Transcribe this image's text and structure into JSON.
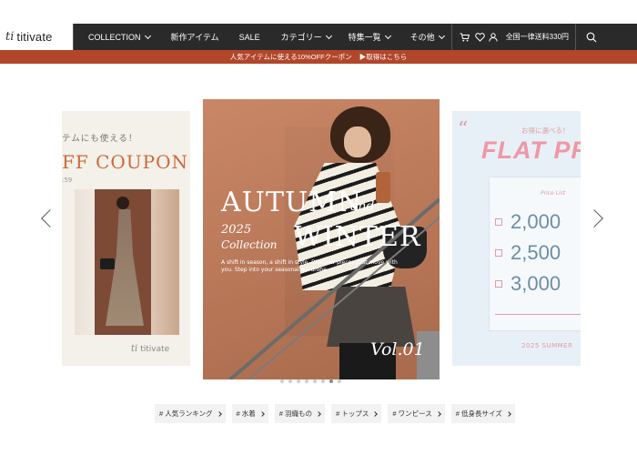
{
  "header": {
    "logo_mark": "ti",
    "logo_text": "titivate",
    "nav": [
      {
        "label": "COLLECTION",
        "dropdown": true
      },
      {
        "label": "新作アイテム",
        "dropdown": false
      },
      {
        "label": "SALE",
        "dropdown": false
      },
      {
        "label": "カテゴリー",
        "dropdown": true
      },
      {
        "label": "特集一覧",
        "dropdown": true
      },
      {
        "label": "その他",
        "dropdown": true
      }
    ],
    "shipping": "全国一律送料330円",
    "icons": [
      "cart-icon",
      "heart-icon",
      "user-icon",
      "search-icon"
    ]
  },
  "coupon_bar": {
    "text": "人気アイテムに使える10%OFFクーポン",
    "link": "▶取得はこちら",
    "color": "#b2462a"
  },
  "carousel": {
    "left_slide": {
      "headline_small": "テムにも使える！",
      "headline": "FF COUPON",
      "subtext": ":59",
      "brand": "titivate"
    },
    "main_slide": {
      "title_1": "AUTUMN",
      "title_and": "and",
      "year": "2025",
      "collection": "Collection",
      "title_2": "WINTER",
      "tagline": "A shift in season, a shift in style. Discover pieces that move with you. Step into your seasonal wardrobe.",
      "volume": "Vol.01"
    },
    "right_slide": {
      "quote": "“",
      "headline_small": "お得に選べる！",
      "headline": "FLAT PR",
      "price_label": "Price List",
      "prices": [
        "2,000",
        "2,500",
        "3,000"
      ],
      "footer": "2025 SUMMER"
    },
    "dot_count": 8,
    "active_dot": 7
  },
  "tags": [
    "# 人気ランキング",
    "# 水着",
    "# 羽織もの",
    "# トップス",
    "# ワンピース",
    "# 低身長サイズ"
  ]
}
